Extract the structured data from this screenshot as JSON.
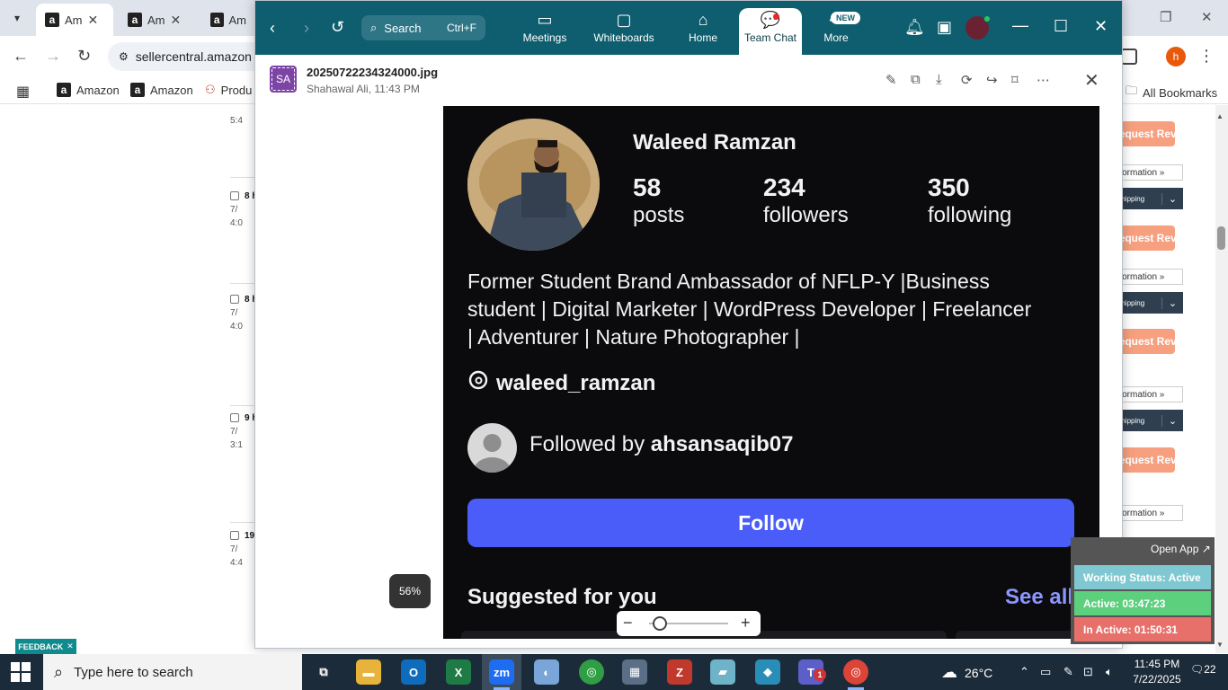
{
  "browser": {
    "tabs": [
      {
        "label": "Am"
      },
      {
        "label": "Am"
      },
      {
        "label": "Am"
      }
    ],
    "url": "sellercentral.amazon",
    "bookmarks": [
      "Amazon",
      "Amazon",
      "Produ"
    ],
    "all_bookmarks": "All Bookmarks",
    "profile_initial": "h"
  },
  "background_page": {
    "rows": [
      {
        "title": "5:4",
        "line1": "",
        "line2": ""
      },
      {
        "title": "8 h",
        "line1": "7/",
        "line2": "4:0"
      },
      {
        "title": "8 h",
        "line1": "7/",
        "line2": "4:0"
      },
      {
        "title": "9 h",
        "line1": "7/",
        "line2": "3:1"
      },
      {
        "title": "19",
        "line1": "7/",
        "line2": "4:4"
      }
    ],
    "request_review": "Request Review",
    "information": "Information »",
    "shipping": "Shipping",
    "feedback": "FEEDBACK"
  },
  "zoom": {
    "search_label": "Search",
    "search_shortcut": "Ctrl+F",
    "nav": [
      {
        "label": "Meetings"
      },
      {
        "label": "Whiteboards"
      },
      {
        "label": "Home"
      },
      {
        "label": "Team Chat"
      },
      {
        "label": "More"
      }
    ],
    "new_badge": "NEW",
    "viewer": {
      "sender_initials": "SA",
      "file_name": "20250722234324000.jpg",
      "meta": "Shahawal Ali, 11:43 PM"
    },
    "zoom_level": "56%",
    "zoom_fraction": 0.14
  },
  "profile": {
    "name": "Waleed Ramzan",
    "stats": [
      {
        "num": "58",
        "label": "posts"
      },
      {
        "num": "234",
        "label": "followers"
      },
      {
        "num": "350",
        "label": "following"
      }
    ],
    "bio_line1": "Former Student Brand Ambassador of NFLP-Y |Business",
    "bio_line2": "student | Digital Marketer | WordPress Developer | Freelancer",
    "bio_line3": "| Adventurer | Nature Photographer |",
    "threads_handle": "waleed_ramzan",
    "followed_by_prefix": "Followed by",
    "followed_by_user": "ahsansaqib07",
    "follow_button": "Follow",
    "suggested": "Suggested for you",
    "see_all": "See all"
  },
  "tracker": {
    "open_app": "Open App ↗",
    "status": "Working Status: Active",
    "active": "Active: 03:47:23",
    "inactive": "In Active: 01:50:31",
    "colors": {
      "status": "#7fc8d2",
      "active": "#5cd07c",
      "inactive": "#e8706a"
    }
  },
  "taskbar": {
    "search_placeholder": "Type here to search",
    "weather": "26°C",
    "weather_badge": "1",
    "time": "11:45 PM",
    "date": "7/22/2025",
    "notifications": "22",
    "teams_badge": "1"
  }
}
